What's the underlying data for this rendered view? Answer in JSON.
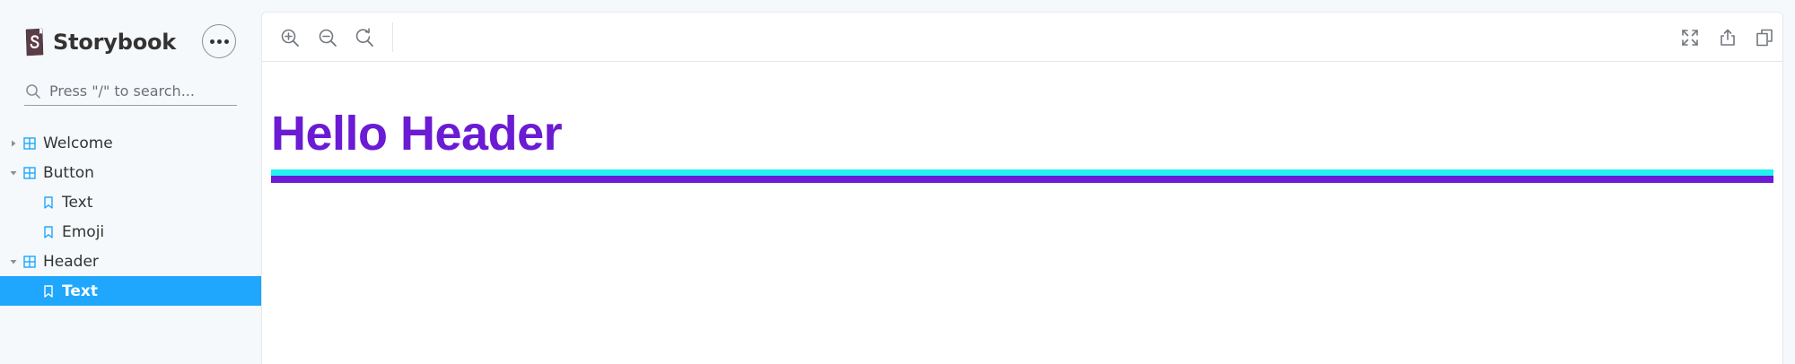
{
  "sidebar": {
    "brand": "Storybook",
    "search_placeholder": "Press \"/\" to search...",
    "items": [
      {
        "label": "Welcome",
        "type": "component",
        "expanded": false
      },
      {
        "label": "Button",
        "type": "component",
        "expanded": true
      },
      {
        "label": "Text",
        "type": "story"
      },
      {
        "label": "Emoji",
        "type": "story"
      },
      {
        "label": "Header",
        "type": "component",
        "expanded": true
      },
      {
        "label": "Text",
        "type": "story",
        "selected": true
      }
    ]
  },
  "toolbar": {
    "left_tools": [
      "zoom-in-icon",
      "zoom-out-icon",
      "zoom-reset-icon"
    ],
    "right_tools": [
      "fullscreen-icon",
      "share-icon",
      "copy-icon"
    ]
  },
  "preview": {
    "heading": "Hello Header"
  },
  "colors": {
    "accent": "#1EA7FD",
    "heading": "#6A1BD3",
    "rule_top": "#22F2F2",
    "rule_bottom": "#6A1BD3",
    "sidebar_bg": "#F6F9FC"
  }
}
